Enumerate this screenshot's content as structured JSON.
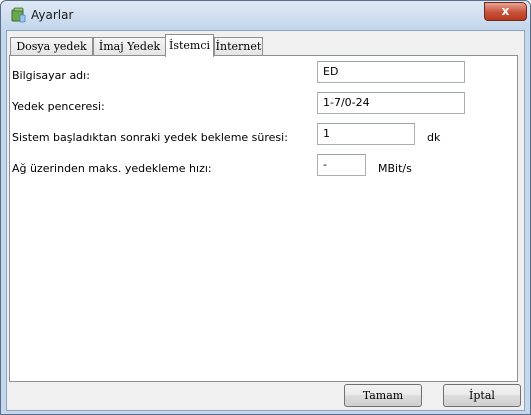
{
  "window": {
    "title": "Ayarlar",
    "close_glyph": "x",
    "app_icon": "database-icon"
  },
  "tabs": [
    {
      "label": "Dosya yedek",
      "active": false
    },
    {
      "label": "İmaj Yedek",
      "active": false
    },
    {
      "label": "İstemci",
      "active": true
    },
    {
      "label": "İnternet",
      "active": false
    }
  ],
  "form": {
    "computer_name_label": "Bilgisayar adı:",
    "computer_name_value": "ED",
    "backup_window_label": "Yedek penceresi:",
    "backup_window_value": "1-7/0-24",
    "wait_time_label": "Sistem başladıktan sonraki yedek bekleme süresi:",
    "wait_time_value": "1",
    "wait_time_unit": "dk",
    "max_speed_label": "Ağ üzerinden maks. yedekleme hızı:",
    "max_speed_value": "-",
    "max_speed_unit": "MBit/s"
  },
  "buttons": {
    "ok": "Tamam",
    "cancel": "İptal"
  },
  "colors": {
    "close_button": "#c7513a",
    "window_frame": "#c5d7ec",
    "panel_background": "#ffffff"
  }
}
